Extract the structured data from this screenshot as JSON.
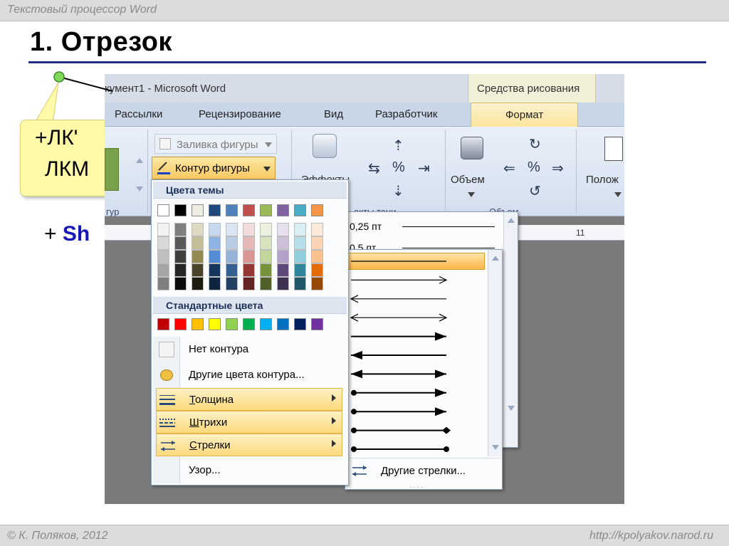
{
  "slide": {
    "header": "Текстовый процессор Word",
    "title": "1. Отрезок",
    "footer_left": "© К. Поляков, 2012",
    "footer_right": "http://kpolyakov.narod.ru",
    "callout_line1": "+ЛК'",
    "callout_line2": "ЛКМ",
    "shift_prefix": "+ ",
    "shift_key": "Sh"
  },
  "window": {
    "title": "кумент1 - Microsoft Word",
    "context_tab": "Средства рисования"
  },
  "tabs": [
    "Рассылки",
    "Рецензирование",
    "Вид",
    "Разработчик",
    "Формат"
  ],
  "ribbon": {
    "fill_button": "Заливка фигуры",
    "outline_button": "Контур фигуры",
    "effects_label": "Эффекты",
    "volume_label": "Объем",
    "position_label": "Полож",
    "group_label_left": "гур",
    "group_label_effects": "екты тени",
    "group_label_volume": "Объем",
    "ruler_number": "11"
  },
  "menu": {
    "theme_colors_header": "Цвета темы",
    "standard_colors_header": "Стандартные цвета",
    "no_outline": "Нет контура",
    "more_outline_colors": "Другие цвета контура...",
    "weight": "Толщина",
    "dashes": "Штрихи",
    "arrows": "Стрелки",
    "pattern": "Узор...",
    "theme_top_row": [
      "#ffffff",
      "#000000",
      "#eeece1",
      "#1f497d",
      "#4f81bd",
      "#c0504d",
      "#9bbb59",
      "#8064a2",
      "#4bacc6",
      "#f79646"
    ],
    "theme_shades": [
      [
        "#f2f2f2",
        "#d8d8d8",
        "#bfbfbf",
        "#a5a5a5",
        "#7f7f7f"
      ],
      [
        "#7f7f7f",
        "#595959",
        "#3f3f3f",
        "#262626",
        "#0c0c0c"
      ],
      [
        "#ddd9c3",
        "#c4bd97",
        "#938953",
        "#494429",
        "#1d1b10"
      ],
      [
        "#c6d9f0",
        "#8db3e2",
        "#548dd4",
        "#17365d",
        "#0f243e"
      ],
      [
        "#dbe5f1",
        "#b8cce4",
        "#95b3d7",
        "#366092",
        "#244061"
      ],
      [
        "#f2dcdb",
        "#e5b9b7",
        "#d99694",
        "#953734",
        "#632423"
      ],
      [
        "#ebf1dd",
        "#d7e3bc",
        "#c3d69b",
        "#76923c",
        "#4f6128"
      ],
      [
        "#e5e0ec",
        "#ccc1d9",
        "#b2a2c7",
        "#5f497a",
        "#3f3151"
      ],
      [
        "#dbeef3",
        "#b7dde8",
        "#92cddc",
        "#31859b",
        "#205867"
      ],
      [
        "#fdeada",
        "#fbd5b5",
        "#fac08f",
        "#e36c09",
        "#974806"
      ]
    ],
    "standard_row": [
      "#c00000",
      "#ff0000",
      "#ffc000",
      "#ffff00",
      "#92d050",
      "#00b050",
      "#00b0f0",
      "#0070c0",
      "#002060",
      "#7030a0"
    ]
  },
  "weight_menu": {
    "items": [
      "0,25 пт",
      "0,5 пт"
    ]
  },
  "arrows_menu": {
    "more_arrows": "Другие стрелки...",
    "styles": [
      "none",
      "right-open",
      "left-open",
      "both-open",
      "right-solid",
      "left-solid",
      "both-solid",
      "dot-right",
      "dot-right-solid",
      "dot-diamond",
      "dot-dot"
    ]
  }
}
